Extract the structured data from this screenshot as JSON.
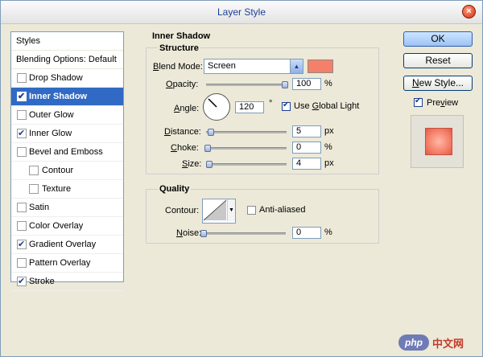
{
  "window": {
    "title": "Layer Style"
  },
  "sidebar": {
    "header": "Styles",
    "blending": "Blending Options: Default",
    "items": [
      {
        "label": "Drop Shadow",
        "checked": false,
        "sub": false,
        "selected": false
      },
      {
        "label": "Inner Shadow",
        "checked": true,
        "sub": false,
        "selected": true
      },
      {
        "label": "Outer Glow",
        "checked": false,
        "sub": false,
        "selected": false
      },
      {
        "label": "Inner Glow",
        "checked": true,
        "sub": false,
        "selected": false
      },
      {
        "label": "Bevel and Emboss",
        "checked": false,
        "sub": false,
        "selected": false
      },
      {
        "label": "Contour",
        "checked": false,
        "sub": true,
        "selected": false
      },
      {
        "label": "Texture",
        "checked": false,
        "sub": true,
        "selected": false
      },
      {
        "label": "Satin",
        "checked": false,
        "sub": false,
        "selected": false
      },
      {
        "label": "Color Overlay",
        "checked": false,
        "sub": false,
        "selected": false
      },
      {
        "label": "Gradient Overlay",
        "checked": true,
        "sub": false,
        "selected": false
      },
      {
        "label": "Pattern Overlay",
        "checked": false,
        "sub": false,
        "selected": false
      },
      {
        "label": "Stroke",
        "checked": true,
        "sub": false,
        "selected": false
      }
    ]
  },
  "inner_shadow": {
    "section_title": "Inner Shadow",
    "structure_title": "Structure",
    "blend_mode_label": "Blend Mode:",
    "blend_mode_value": "Screen",
    "shadow_color": "#f5806a",
    "opacity_label": "Opacity:",
    "opacity_value": "100",
    "opacity_unit": "%",
    "angle_label": "Angle:",
    "angle_value": "120",
    "angle_unit": "°",
    "use_global_light": "Use Global Light",
    "distance_label": "Distance:",
    "distance_value": "5",
    "distance_unit": "px",
    "choke_label": "Choke:",
    "choke_value": "0",
    "choke_unit": "%",
    "size_label": "Size:",
    "size_value": "4",
    "size_unit": "px"
  },
  "quality": {
    "title": "Quality",
    "contour_label": "Contour:",
    "anti_aliased": "Anti-aliased",
    "noise_label": "Noise:",
    "noise_value": "0",
    "noise_unit": "%"
  },
  "buttons": {
    "ok": "OK",
    "reset": "Reset",
    "new_style": "New Style...",
    "preview": "Preview"
  },
  "watermark": {
    "logo": "php",
    "text": "中文网"
  }
}
